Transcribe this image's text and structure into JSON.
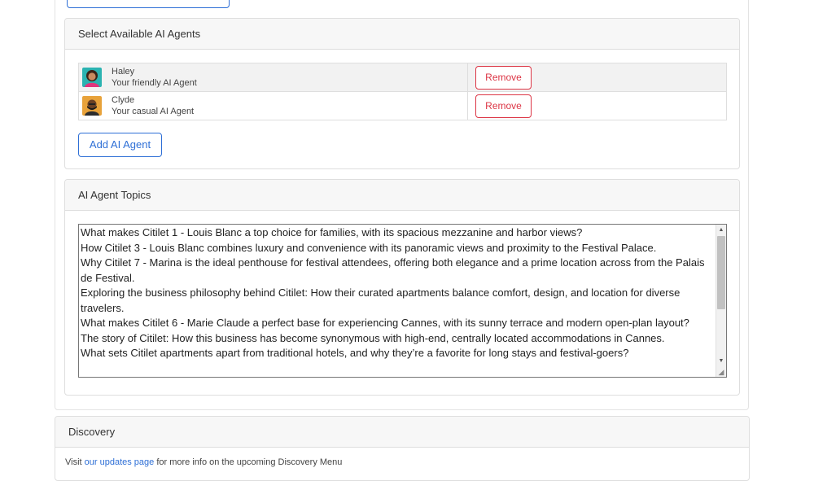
{
  "agents_section": {
    "title": "Select Available AI Agents",
    "agents": [
      {
        "name": "Haley",
        "description": "Your friendly AI Agent",
        "remove_label": "Remove",
        "avatar_icon": "female-avatar-icon"
      },
      {
        "name": "Clyde",
        "description": "Your casual AI Agent",
        "remove_label": "Remove",
        "avatar_icon": "male-avatar-icon"
      }
    ],
    "add_label": "Add AI Agent"
  },
  "topics_section": {
    "title": "AI Agent Topics",
    "topics": [
      "What makes Citilet 1 - Louis Blanc a top choice for families, with its spacious mezzanine and harbor views?",
      "How Citilet 3 - Louis Blanc combines luxury and convenience with its panoramic views and proximity to the Festival Palace.",
      "Why Citilet 7 - Marina is the ideal penthouse for festival attendees, offering both elegance and a prime location across from the Palais de Festival.",
      "Exploring the business philosophy behind Citilet: How their curated apartments balance comfort, design, and location for diverse travelers.",
      "What makes Citilet 6 - Marie Claude a perfect base for experiencing Cannes, with its sunny terrace and modern open-plan layout?",
      "The story of Citilet: How this business has become synonymous with high-end, centrally located accommodations in Cannes.",
      "What sets Citilet apartments apart from traditional hotels, and why they’re a favorite for long stays and festival-goers?"
    ]
  },
  "discovery_section": {
    "title": "Discovery",
    "text_before": "Visit ",
    "link_text": "our updates page",
    "text_after": " for more info on the upcoming Discovery Menu"
  },
  "colors": {
    "primary": "#2e6fd6",
    "danger": "#dc3545"
  }
}
